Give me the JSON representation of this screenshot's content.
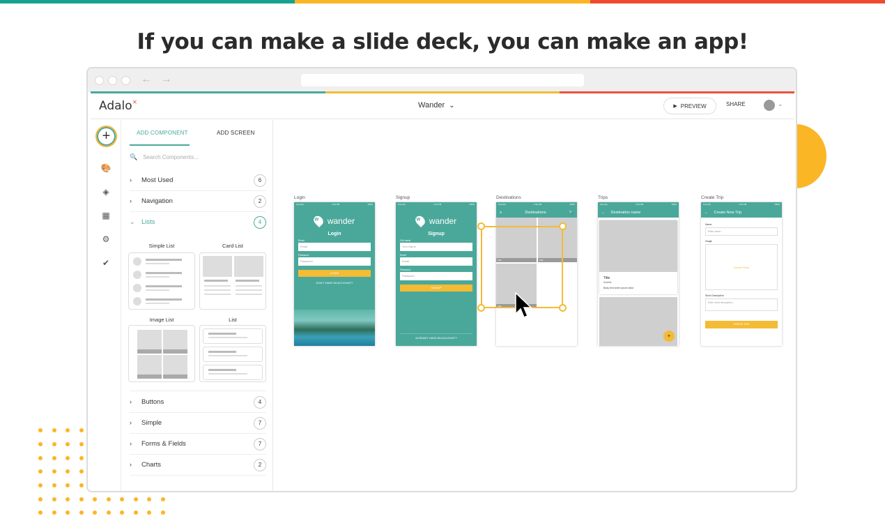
{
  "page": {
    "headline": "If you can make a slide deck, you can make an app!",
    "top_stripe_colors": [
      "#18a38f",
      "#fbb626",
      "#ef4a2f"
    ]
  },
  "browser": {
    "nav_arrows": "← →"
  },
  "app": {
    "logo_text": "Adalo",
    "logo_mark": "×",
    "title": "Wander",
    "title_chevron": "⌄",
    "preview_label": "PREVIEW",
    "preview_icon": "▶",
    "share_label": "SHARE",
    "avatar_chevron": "⌄",
    "accent": "#4aa89a",
    "brand_yellow": "#f4bb35"
  },
  "rail": {
    "add_icon": "+",
    "items": [
      {
        "name": "palette-icon",
        "glyph": "🎨"
      },
      {
        "name": "layers-icon",
        "glyph": "◈"
      },
      {
        "name": "grid-icon",
        "glyph": "▦"
      },
      {
        "name": "gear-icon",
        "glyph": "⚙"
      },
      {
        "name": "checks-icon",
        "glyph": "✔"
      }
    ]
  },
  "panel": {
    "tabs": {
      "add_component": "ADD COMPONENT",
      "add_screen": "ADD SCREEN"
    },
    "search_placeholder": "Search Components...",
    "search_icon": "🔍",
    "categories_top": [
      {
        "label": "Most Used",
        "count": "6",
        "chev": "›"
      },
      {
        "label": "Navigation",
        "count": "2",
        "chev": "›"
      },
      {
        "label": "Lists",
        "count": "4",
        "chev": "⌄"
      }
    ],
    "list_components": [
      "Simple List",
      "Card List",
      "Image List",
      "List"
    ],
    "categories_bottom": [
      {
        "label": "Buttons",
        "count": "4",
        "chev": "›"
      },
      {
        "label": "Simple",
        "count": "7",
        "chev": "›"
      },
      {
        "label": "Forms & Fields",
        "count": "7",
        "chev": "›"
      },
      {
        "label": "Charts",
        "count": "2",
        "chev": "›"
      }
    ]
  },
  "canvas": {
    "screen_labels": [
      "Login",
      "Signup",
      "Destinations",
      "Trips",
      "Create Trip"
    ],
    "brand": "wander",
    "login": {
      "title": "Login",
      "email_label": "Email",
      "email_placeholder": "Email",
      "password_label": "Password",
      "password_placeholder": "Password",
      "button": "LOGIN",
      "link": "DON'T HAVE AN ACCOUNT?"
    },
    "signup": {
      "title": "Signup",
      "name_label": "Full name",
      "name_placeholder": "Your Name",
      "email_label": "Email",
      "email_placeholder": "Email",
      "password_label": "Password",
      "password_placeholder": "Password",
      "button": "SIGNUP",
      "link": "ALREADY HAVE AN ACCOUNT?"
    },
    "destinations": {
      "appbar_title": "Destinations",
      "menu_icon": "≡",
      "search_icon": "🔍",
      "card_label": "Title"
    },
    "trips": {
      "appbar_title": "Destination name",
      "back_icon": "←",
      "card_title": "Title",
      "card_subtitle": "Subtitle",
      "card_body": "Body text lorem ipsum dolor",
      "fab": "+"
    },
    "create_trip": {
      "appbar_title": "Create New Trip",
      "back_icon": "←",
      "name_label": "Name",
      "name_placeholder": "Enter name...",
      "image_label": "Image",
      "image_action": "Choose Photo",
      "desc_label": "Short Description",
      "desc_placeholder": "Enter short description...",
      "button": "CREATE TRIP"
    },
    "status_bar": {
      "left": "Foundry",
      "mid": "2:16 PM",
      "right": "100%"
    },
    "cursor_icon": "➤"
  }
}
